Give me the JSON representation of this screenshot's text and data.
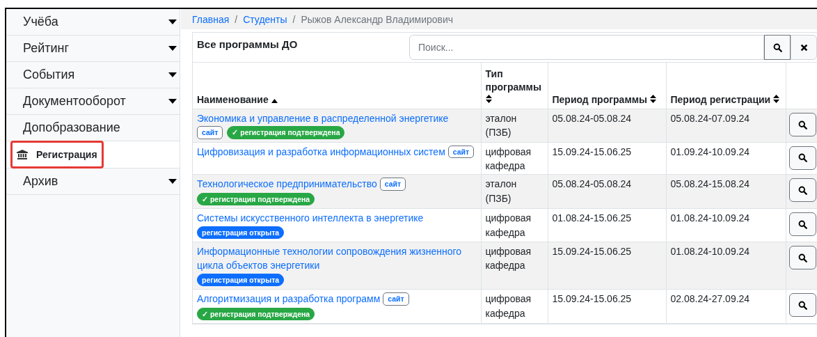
{
  "sidebar": {
    "items": [
      {
        "label": "Учёба",
        "expanded": false,
        "selected": false
      },
      {
        "label": "Рейтинг",
        "expanded": false,
        "selected": false
      },
      {
        "label": "События",
        "expanded": false,
        "selected": false
      },
      {
        "label": "Документооборот",
        "expanded": false,
        "selected": false
      },
      {
        "label": "Допобразование",
        "expanded": true,
        "selected": false,
        "children": [
          {
            "label": "Регистрация",
            "selected": true,
            "outlined": true
          }
        ]
      },
      {
        "label": "Архив",
        "expanded": false,
        "selected": false
      }
    ]
  },
  "breadcrumb": {
    "separator": "/",
    "items": [
      {
        "label": "Главная",
        "kind": "link"
      },
      {
        "label": "Студенты",
        "kind": "link"
      },
      {
        "label": "Рыжов Александр Владимирович",
        "kind": "current"
      }
    ]
  },
  "card": {
    "title": "Все программы ДО",
    "search": {
      "placeholder": "Поиск..."
    }
  },
  "table": {
    "columns": [
      {
        "label": "Наименование",
        "sorted": true
      },
      {
        "label": "Тип программы",
        "sorted": false
      },
      {
        "label": "Период программы",
        "sorted": false
      },
      {
        "label": "Период регистрации",
        "sorted": false
      }
    ],
    "rows": [
      {
        "name": "Экономика и управление в распределенной энергетике",
        "badges": [
          {
            "kind": "site",
            "label": "сайт"
          },
          {
            "kind": "confirmed",
            "label": "✓ регистрация подтверждена"
          }
        ],
        "type": "эталон (ПЗБ)",
        "program_period": "05.08.24-05.08.24",
        "registration_period": "05.08.24-07.09.24"
      },
      {
        "name": "Цифровизация и разработка информационных систем",
        "badges": [
          {
            "kind": "site",
            "label": "сайт"
          }
        ],
        "type": "цифровая кафедра",
        "program_period": "15.09.24-15.06.25",
        "registration_period": "01.09.24-10.09.24"
      },
      {
        "name": "Технологическое предпринимательство",
        "badges": [
          {
            "kind": "site",
            "label": "сайт"
          },
          {
            "kind": "confirmed",
            "label": "✓ регистрация подтверждена"
          }
        ],
        "type": "эталон (ПЗБ)",
        "program_period": "05.08.24-05.08.24",
        "registration_period": "05.08.24-15.08.24"
      },
      {
        "name": "Системы искусственного интеллекта в энергетике",
        "badges": [
          {
            "kind": "open",
            "label": "регистрация открыта"
          }
        ],
        "type": "цифровая кафедра",
        "program_period": "01.08.24-15.06.25",
        "registration_period": "01.08.24-10.09.24"
      },
      {
        "name": "Информационные технологии сопровождения жизненного цикла объектов энергетики",
        "badges": [
          {
            "kind": "open",
            "label": "регистрация открыта"
          }
        ],
        "type": "цифровая кафедра",
        "program_period": "15.09.24-15.06.25",
        "registration_period": "01.08.24-10.09.24"
      },
      {
        "name": "Алгоритмизация и разработка программ",
        "badges": [
          {
            "kind": "site",
            "label": "сайт"
          },
          {
            "kind": "confirmed",
            "label": "✓ регистрация подтверждена"
          }
        ],
        "type": "цифровая кафедра",
        "program_period": "15.09.24-15.06.25",
        "registration_period": "02.08.24-27.09.24"
      }
    ]
  }
}
